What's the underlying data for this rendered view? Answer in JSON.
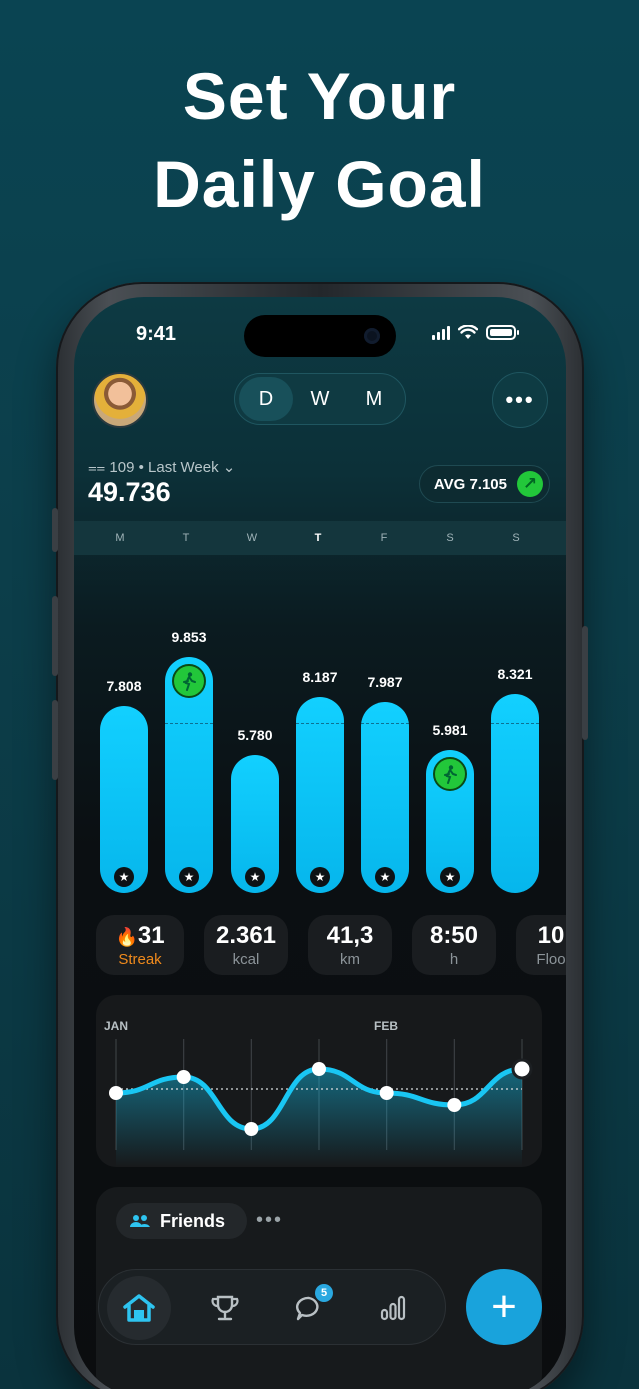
{
  "headline": {
    "line1": "Set Your",
    "line2": "Daily Goal"
  },
  "status": {
    "time": "9:41"
  },
  "segment": {
    "options": [
      "D",
      "W",
      "M"
    ],
    "selected": "D"
  },
  "summary": {
    "range_label": "109 • Last Week",
    "total": "49.736",
    "avg_label": "AVG 7.105"
  },
  "days": [
    "M",
    "T",
    "W",
    "T",
    "F",
    "S",
    "S"
  ],
  "chart_data": {
    "type": "bar",
    "categories": [
      "M",
      "T",
      "W",
      "T",
      "F",
      "S",
      "S"
    ],
    "values": [
      7.808,
      9.853,
      5.78,
      8.187,
      7.987,
      5.981,
      8.321
    ],
    "labels": [
      "7.808",
      "9.853",
      "5.780",
      "8.187",
      "7.987",
      "5.981",
      "8.321"
    ],
    "goal_line": 7.1,
    "ylim": [
      0,
      10.2
    ],
    "goal_badge_days": [
      1,
      5
    ],
    "star_days": [
      0,
      1,
      2,
      3,
      4,
      5
    ]
  },
  "stats": [
    {
      "value": "31",
      "label": "Streak",
      "icon": "fire-icon"
    },
    {
      "value": "2.361",
      "label": "kcal"
    },
    {
      "value": "41,3",
      "label": "km"
    },
    {
      "value": "8:50",
      "label": "h"
    },
    {
      "value": "10",
      "label": "Floo"
    }
  ],
  "trend": {
    "months": [
      "JAN",
      "FEB"
    ],
    "values": [
      6.6,
      7.4,
      4.8,
      7.8,
      6.6,
      6.0,
      7.8
    ],
    "baseline": 6.8,
    "ylim": [
      4,
      9
    ]
  },
  "friends": {
    "label": "Friends",
    "more": "•••"
  },
  "tabbar": {
    "items": [
      "home-icon",
      "trophy-icon",
      "chat-icon",
      "stats-icon"
    ],
    "chat_badge": "5"
  },
  "colors": {
    "accent": "#12d0ff",
    "goal_green": "#22c73a",
    "streak_orange": "#f08a1c"
  }
}
